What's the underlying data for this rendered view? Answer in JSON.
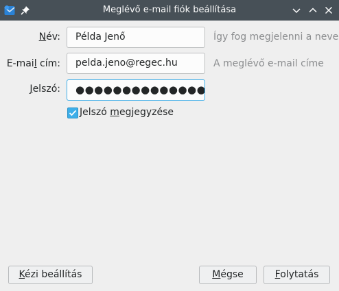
{
  "window": {
    "title": "Meglévő e-mail fiók beállítása",
    "controls": [
      "minimize-icon",
      "maximize-icon",
      "close-icon"
    ]
  },
  "form": {
    "name": {
      "label_pre": "",
      "label_ul": "N",
      "label_post": "év:",
      "value": "Példa Jenő",
      "hint": "Így fog megjelenni a neve"
    },
    "email": {
      "label_pre": "E-mai",
      "label_ul": "l",
      "label_post": " cím:",
      "value": "pelda.jeno@regec.hu",
      "hint": "A meglévő e-mail címe"
    },
    "password": {
      "label_pre": "",
      "label_ul": "J",
      "label_post": "elszó:",
      "masked": "●●●●●●●●●●●●●●●"
    },
    "remember": {
      "checked": true,
      "label_pre": "Jelszó ",
      "label_ul": "m",
      "label_post": "egjegyzése"
    }
  },
  "buttons": {
    "manual": {
      "pre": "",
      "ul": "K",
      "post": "ézi beállítás"
    },
    "cancel": {
      "pre": "",
      "ul": "M",
      "post": "égse"
    },
    "continue": {
      "pre": "",
      "ul": "F",
      "post": "olytatás"
    }
  },
  "colors": {
    "titlebar": "#475057",
    "accent": "#3daee9",
    "hint": "#8b8d8f",
    "window": "#efefef"
  }
}
